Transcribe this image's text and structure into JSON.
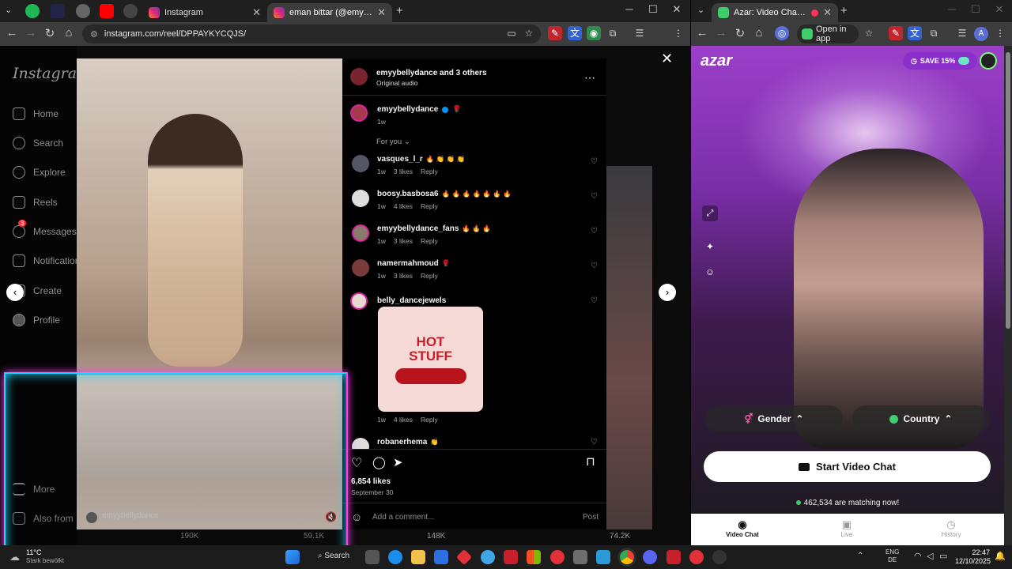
{
  "left_browser": {
    "tabs": [
      {
        "title": "Instagram"
      },
      {
        "title": "eman bittar (@emyybellydance"
      }
    ],
    "url": "instagram.com/reel/DPPAYKYCQJS/"
  },
  "instagram": {
    "logo": "Instagram",
    "sidebar": [
      "Home",
      "Search",
      "Explore",
      "Reels",
      "Messages",
      "Notifications",
      "Create",
      "Profile",
      "More",
      "Also from Meta"
    ],
    "messages_badge": "3",
    "post": {
      "author": "emyybellydance",
      "and_others": "and 3 others",
      "audio": "Original audio",
      "caption_user": "emyybellydance",
      "caption_emoji": "🌹",
      "caption_time": "1w",
      "for_you": "For you",
      "overlay_user": "emyybellydance",
      "likes": "6,854 likes",
      "date": "September 30",
      "add_comment": "Add a comment...",
      "post_btn": "Post"
    },
    "comments": [
      {
        "user": "vasques_l_r",
        "text": "🔥 👏 👏 👏",
        "time": "1w",
        "likes": "3 likes",
        "reply": "Reply"
      },
      {
        "user": "boosy.basbosa6",
        "text": "🔥 🔥 🔥 🔥 🔥 🔥 🔥",
        "time": "1w",
        "likes": "4 likes",
        "reply": "Reply"
      },
      {
        "user": "emyybellydance_fans",
        "text": "🔥 🔥 🔥",
        "time": "1w",
        "likes": "3 likes",
        "reply": "Reply"
      },
      {
        "user": "namermahmoud",
        "text": "🌹",
        "time": "1w",
        "likes": "3 likes",
        "reply": "Reply"
      },
      {
        "user": "belly_dancejewels",
        "text": "",
        "time": "1w",
        "likes": "4 likes",
        "reply": "Reply",
        "sticker": "HOT STUFF"
      },
      {
        "user": "robanerhema",
        "text": "👏",
        "time": "",
        "likes": "",
        "reply": ""
      }
    ],
    "bg_counts": [
      "190K",
      "59.1K",
      "148K",
      "74.2K"
    ]
  },
  "right_browser": {
    "tab_title": "Azar: Video Chat | Alternati",
    "open_in_app": "Open in app"
  },
  "azar": {
    "logo": "azar",
    "save_badge": "SAVE 15%",
    "gender": "Gender",
    "country": "Country",
    "start": "Start Video Chat",
    "matching": "462,534 are matching now!",
    "nav": [
      "Video Chat",
      "Live",
      "History"
    ]
  },
  "taskbar": {
    "temp": "11°C",
    "weather": "Stark bewölkt",
    "search": "Search",
    "lang1": "ENG",
    "lang2": "DE",
    "time": "22:47",
    "date": "12/10/2025"
  },
  "colors": {
    "ig_blue": "#0095f6",
    "azar_purple": "#9b3fc9",
    "neon_cyan": "#22d3ff",
    "neon_pink": "#ff3df0"
  }
}
